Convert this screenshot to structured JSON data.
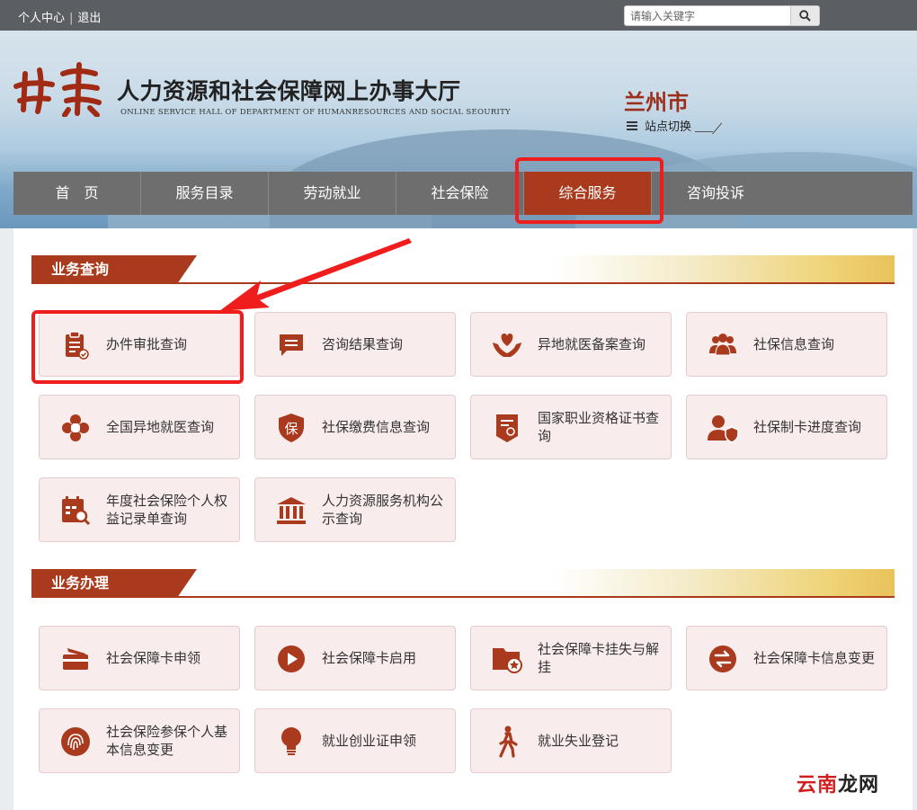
{
  "topbar": {
    "user_center": "个人中心",
    "separator": "|",
    "logout": "退出",
    "search_placeholder": "请输入关键字"
  },
  "header": {
    "title": "人力资源和社会保障网上办事大厅",
    "subtitle": "ONLINE SERVICE HALL OF DEPARTMENT OF HUMANRESOURCES AND SOCIAL SEOURITY",
    "logo_text": "甘肃",
    "city": "兰州市",
    "switch_label": "站点切换"
  },
  "nav": {
    "items": [
      {
        "label": "首　页"
      },
      {
        "label": "服务目录"
      },
      {
        "label": "劳动就业"
      },
      {
        "label": "社会保险"
      },
      {
        "label": "综合服务"
      },
      {
        "label": "咨询投诉"
      }
    ],
    "active_index": 4
  },
  "sections": [
    {
      "title": "业务查询",
      "cards": [
        {
          "label": "办件审批查询",
          "icon": "clipboard-check-icon"
        },
        {
          "label": "咨询结果查询",
          "icon": "chat-bubble-icon"
        },
        {
          "label": "异地就医备案查询",
          "icon": "hands-heart-icon"
        },
        {
          "label": "社保信息查询",
          "icon": "people-group-icon"
        },
        {
          "label": "全国异地就医查询",
          "icon": "medical-cross-icon"
        },
        {
          "label": "社保缴费信息查询",
          "icon": "shield-bao-icon"
        },
        {
          "label": "国家职业资格证书查询",
          "icon": "certificate-icon"
        },
        {
          "label": "社保制卡进度查询",
          "icon": "user-shield-icon"
        },
        {
          "label": "年度社会保险个人权益记录单查询",
          "icon": "calendar-search-icon"
        },
        {
          "label": "人力资源服务机构公示查询",
          "icon": "institution-icon"
        }
      ]
    },
    {
      "title": "业务办理",
      "cards": [
        {
          "label": "社会保障卡申领",
          "icon": "card-icon"
        },
        {
          "label": "社会保障卡启用",
          "icon": "play-circle-icon"
        },
        {
          "label": "社会保障卡挂失与解挂",
          "icon": "folder-star-icon"
        },
        {
          "label": "社会保障卡信息变更",
          "icon": "exchange-icon"
        },
        {
          "label": "社会保险参保个人基本信息变更",
          "icon": "fingerprint-icon"
        },
        {
          "label": "就业创业证申领",
          "icon": "lightbulb-icon"
        },
        {
          "label": "就业失业登记",
          "icon": "walking-person-icon"
        }
      ]
    }
  ],
  "colors": {
    "accent": "#a93a1d",
    "nav_bg": "#6e6e6e",
    "card_bg": "#f9ecec",
    "highlight_red": "#f01d1d"
  },
  "watermark": {
    "part1": "云南",
    "part2": "龙网"
  }
}
